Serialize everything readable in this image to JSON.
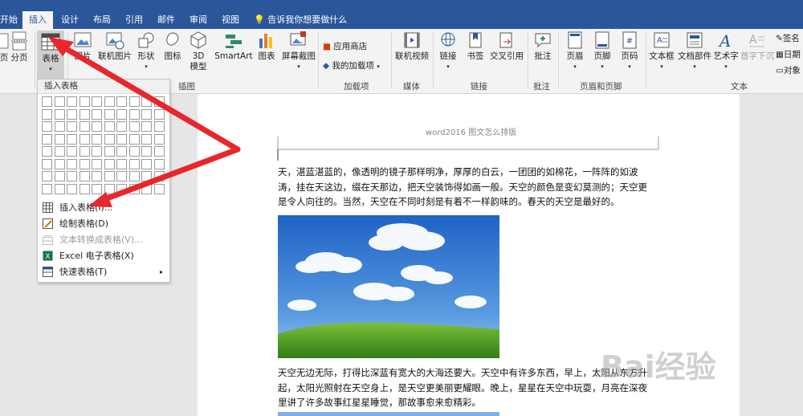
{
  "tabs": [
    "开始",
    "插入",
    "设计",
    "布局",
    "引用",
    "邮件",
    "审阅",
    "视图"
  ],
  "active_tab": "插入",
  "tell_me": "告诉我你想要做什么",
  "ribbon": {
    "fen_ye": "分页",
    "ye": "页",
    "biaoge": "表格",
    "tupian": "图片",
    "lianji_tupian": "联机图片",
    "xingzhuang": "形状",
    "tubiao": "图标",
    "model_3d": "3D\n模型",
    "smartart": "SmartArt",
    "chart": "图表",
    "pingmu_jietu": "屏幕截图",
    "group_illustrations": "插图",
    "app_store": "应用商店",
    "my_addins": "我的加载项",
    "group_addins": "加载项",
    "online_video": "联机视频",
    "group_media": "媒体",
    "link": "链接",
    "bookmark": "书签",
    "cross_ref": "交叉引用",
    "group_links": "链接",
    "comment": "批注",
    "group_comments": "批注",
    "header": "页眉",
    "footer": "页脚",
    "page_number": "页码",
    "group_header_footer": "页眉和页脚",
    "textbox": "文本框",
    "quickparts": "文档部件",
    "wordart": "艺术字",
    "dropcap": "首字下沉",
    "group_text": "文本",
    "sign": "签名",
    "date": "日期",
    "object": "对象"
  },
  "dropdown": {
    "title": "插入表格",
    "items": [
      {
        "label": "插入表格(I)...",
        "disabled": false
      },
      {
        "label": "绘制表格(D)",
        "disabled": false
      },
      {
        "label": "文本转换成表格(V)...",
        "disabled": true
      },
      {
        "label": "Excel 电子表格(X)",
        "disabled": false
      },
      {
        "label": "快速表格(T)",
        "disabled": false
      }
    ]
  },
  "document": {
    "header_text": "word2016 图文怎么排版",
    "para1": "天，湛蓝湛蓝的，像透明的镜子那样明净，厚厚的白云，一团团的如棉花，一阵阵的如波涛，挂在天这边，缀在天那边，把天空装饰得如画一般。天空的颜色是变幻莫测的；天空更是令人向往的。当然，天空在不同时刻是有着不一样韵味的。春天的天空是最好的。",
    "para2": "天空无边无际，打得比深蓝有宽大的大海还要大。天空中有许多东西，早上，太阳从东方升起，太阳光照射在天空身上，是天空更美丽更耀眼。晚上，星星在天空中玩耍，月亮在深夜里讲了许多故事红星星睡觉，那故事愈来愈精彩。"
  },
  "watermark": "Bai经验",
  "colors": {
    "ribbon_blue": "#2b579a",
    "arrow_red": "#e8262b"
  }
}
